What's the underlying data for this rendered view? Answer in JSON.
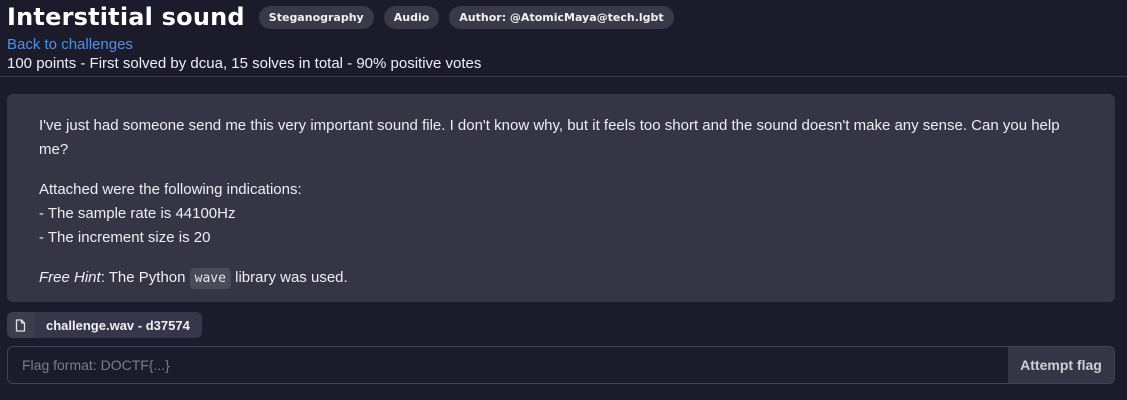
{
  "challenge": {
    "title": "Interstitial sound",
    "tags": [
      "Steganography",
      "Audio",
      "Author: @AtomicMaya@tech.lgbt"
    ],
    "back_link": "Back to challenges",
    "meta": "100 points - First solved by dcua, 15 solves in total - 90% positive votes"
  },
  "description": {
    "para1": "I've just had someone send me this very important sound file. I don't know why, but it feels too short and the sound doesn't make any sense. Can you help me?",
    "indications_intro": "Attached were the following indications:",
    "indication1": "- The sample rate is 44100Hz",
    "indication2": "- The increment size is 20",
    "hint_label": "Free Hint",
    "hint_before": ": The Python ",
    "hint_code": "wave",
    "hint_after": " library was used."
  },
  "attachment": {
    "icon": "file-icon",
    "name": "challenge.wav - d37574"
  },
  "flag": {
    "placeholder": "Flag format: DOCTF{...}",
    "value": "",
    "submit_label": "Attempt flag"
  }
}
